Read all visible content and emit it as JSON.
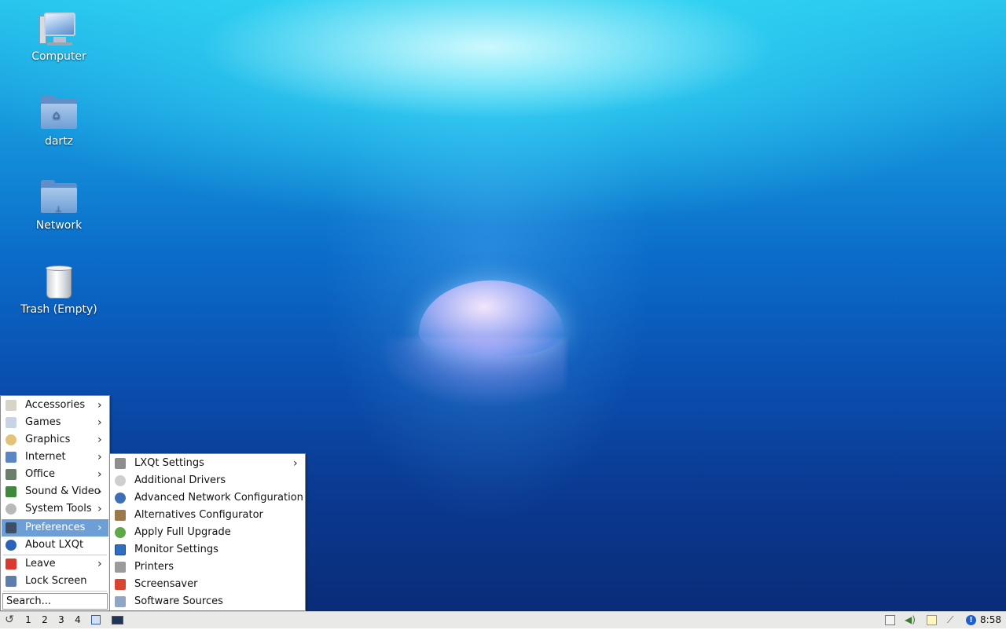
{
  "desktop": {
    "icons": [
      {
        "label": "Computer",
        "icon": "computer-icon"
      },
      {
        "label": "dartz",
        "icon": "home-folder-icon"
      },
      {
        "label": "Network",
        "icon": "network-folder-icon"
      },
      {
        "label": "Trash (Empty)",
        "icon": "trash-icon"
      }
    ]
  },
  "main_menu": {
    "items": [
      {
        "label": "Accessories",
        "icon": "accessories-icon",
        "submenu": true
      },
      {
        "label": "Games",
        "icon": "games-icon",
        "submenu": true
      },
      {
        "label": "Graphics",
        "icon": "graphics-icon",
        "submenu": true
      },
      {
        "label": "Internet",
        "icon": "internet-icon",
        "submenu": true
      },
      {
        "label": "Office",
        "icon": "office-icon",
        "submenu": true
      },
      {
        "label": "Sound & Video",
        "icon": "sound-video-icon",
        "submenu": true
      },
      {
        "label": "System Tools",
        "icon": "system-tools-icon",
        "submenu": true
      },
      {
        "label": "Preferences",
        "icon": "preferences-icon",
        "submenu": true,
        "active": true
      },
      {
        "label": "About LXQt",
        "icon": "info-icon",
        "submenu": false
      },
      {
        "label": "Leave",
        "icon": "power-icon",
        "submenu": true
      },
      {
        "label": "Lock Screen",
        "icon": "lock-screen-icon",
        "submenu": false
      }
    ],
    "search_placeholder": "Search..."
  },
  "preferences_menu": {
    "items": [
      {
        "label": "LXQt Settings",
        "icon": "tools-icon",
        "submenu": true
      },
      {
        "label": "Additional Drivers",
        "icon": "drivers-icon"
      },
      {
        "label": "Advanced Network Configuration",
        "icon": "network-config-icon"
      },
      {
        "label": "Alternatives Configurator",
        "icon": "alternatives-icon"
      },
      {
        "label": "Apply Full Upgrade",
        "icon": "upgrade-icon"
      },
      {
        "label": "Monitor Settings",
        "icon": "monitor-icon"
      },
      {
        "label": "Printers",
        "icon": "printer-icon"
      },
      {
        "label": "Screensaver",
        "icon": "screensaver-icon"
      },
      {
        "label": "Software Sources",
        "icon": "software-sources-icon"
      }
    ]
  },
  "taskbar": {
    "desktops": [
      "1",
      "2",
      "3",
      "4"
    ],
    "clock": "8:58",
    "tray_icons": [
      "clipboard-icon",
      "volume-icon",
      "notes-icon",
      "network-tools-icon",
      "update-alert-icon"
    ]
  },
  "colors": {
    "menu_highlight": "#6d9fd6",
    "taskbar_bg": "#e9e9e7",
    "desktop_deep": "#0a2c78",
    "desktop_light": "#29c7ee"
  }
}
